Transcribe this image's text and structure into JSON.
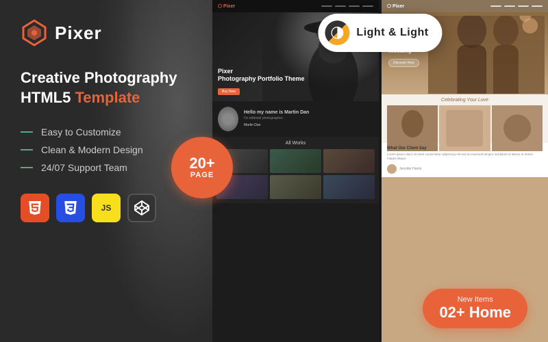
{
  "brand": {
    "name": "Pixer",
    "tagline_line1": "Creative Photography",
    "tagline_line2": "HTML5",
    "tagline_highlight": "Template"
  },
  "features": [
    "Easy to Customize",
    "Clean & Modern Design",
    "24/07 Support Team"
  ],
  "badge": {
    "number": "20+",
    "label": "PAGE"
  },
  "new_items": {
    "label": "New Items",
    "value": "02+ Home"
  },
  "toggle_button": {
    "text": "Light & Light"
  },
  "tech": [
    {
      "name": "HTML5",
      "short": "5"
    },
    {
      "name": "CSS3",
      "short": "3"
    },
    {
      "name": "JavaScript",
      "short": "JS"
    },
    {
      "name": "CodePen",
      "short": "◈"
    }
  ],
  "mock_left": {
    "logo": "Pixer",
    "hero_title": "Pixer\nPhotography Portfolio Theme",
    "profile_name": "Martin Dan",
    "profile_desc": "Hello my name is Martin Dan\nI'm editorial photographer.",
    "grid_title": "All Works"
  },
  "mock_right": {
    "logo": "Pixer",
    "hero_title": "Let's Plan Your\nWedding",
    "celebrating": "Celebrating Your Love",
    "testimonial_title": "What Our Client Say"
  }
}
